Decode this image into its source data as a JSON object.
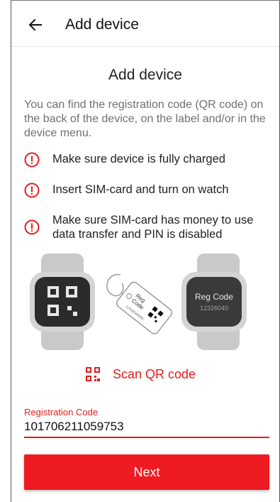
{
  "appbar": {
    "title": "Add device",
    "back_icon": "arrow-left-icon"
  },
  "main": {
    "heading": "Add device",
    "description": "You can find the registration code (QR code) on the back of the device, on the label and/or in the device menu.",
    "requirements": [
      {
        "icon": "alert-circle-icon",
        "text": "Make sure device is fully charged"
      },
      {
        "icon": "alert-circle-icon",
        "text": "Insert SIM-card and turn on watch"
      },
      {
        "icon": "alert-circle-icon",
        "text": "Make sure SIM-card has money to use data transfer and PIN is disabled"
      }
    ]
  },
  "illustration": {
    "tag_line1": "Reg",
    "tag_line2": "Code",
    "tag_number": "12326040050",
    "watch_label": "Reg Code",
    "watch_number": "12326040"
  },
  "scan": {
    "label": "Scan QR code",
    "icon": "qr-code-icon"
  },
  "registration": {
    "label": "Registration Code",
    "value": "101706211059753"
  },
  "next_button": {
    "label": "Next"
  },
  "colors": {
    "accent": "#e31d1d",
    "button": "#ee1b22"
  }
}
